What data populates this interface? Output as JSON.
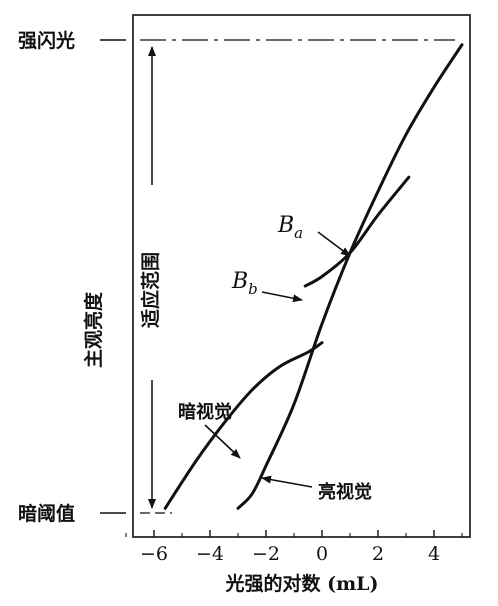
{
  "chart_data": {
    "type": "line",
    "xlabel": "光强的对数 (mL)",
    "ylabel": "主观亮度",
    "x_ticks": [
      "−6",
      "−4",
      "−2",
      "0",
      "2",
      "4"
    ],
    "xlim": [
      -7,
      7
    ],
    "y_levels": {
      "top": "强闪光",
      "bottom": "暗阈值"
    },
    "range_label": "适应范围",
    "series": [
      {
        "name": "亮视觉",
        "x": [
          -3.0,
          -2.5,
          -2.0,
          -1.0,
          0.0,
          1.0,
          2.0,
          3.0,
          4.0,
          5.0
        ],
        "y": [
          0.01,
          0.04,
          0.1,
          0.23,
          0.4,
          0.55,
          0.68,
          0.8,
          0.9,
          0.99
        ]
      },
      {
        "name": "暗视觉",
        "x": [
          -5.6,
          -4.5,
          -3.5,
          -2.5,
          -1.5,
          -0.5,
          0.0
        ],
        "y": [
          0.01,
          0.11,
          0.19,
          0.26,
          0.31,
          0.34,
          0.36
        ]
      },
      {
        "name": "B_a/B_b",
        "x": [
          -0.6,
          0.0,
          1.0,
          2.0,
          3.1
        ],
        "y": [
          0.48,
          0.5,
          0.55,
          0.63,
          0.71
        ]
      }
    ],
    "annotations": {
      "ba_main": "B",
      "ba_sub": "a",
      "bb_main": "B",
      "bb_sub": "b",
      "dark_curve": "暗视觉",
      "bright_curve": "亮视觉"
    }
  }
}
